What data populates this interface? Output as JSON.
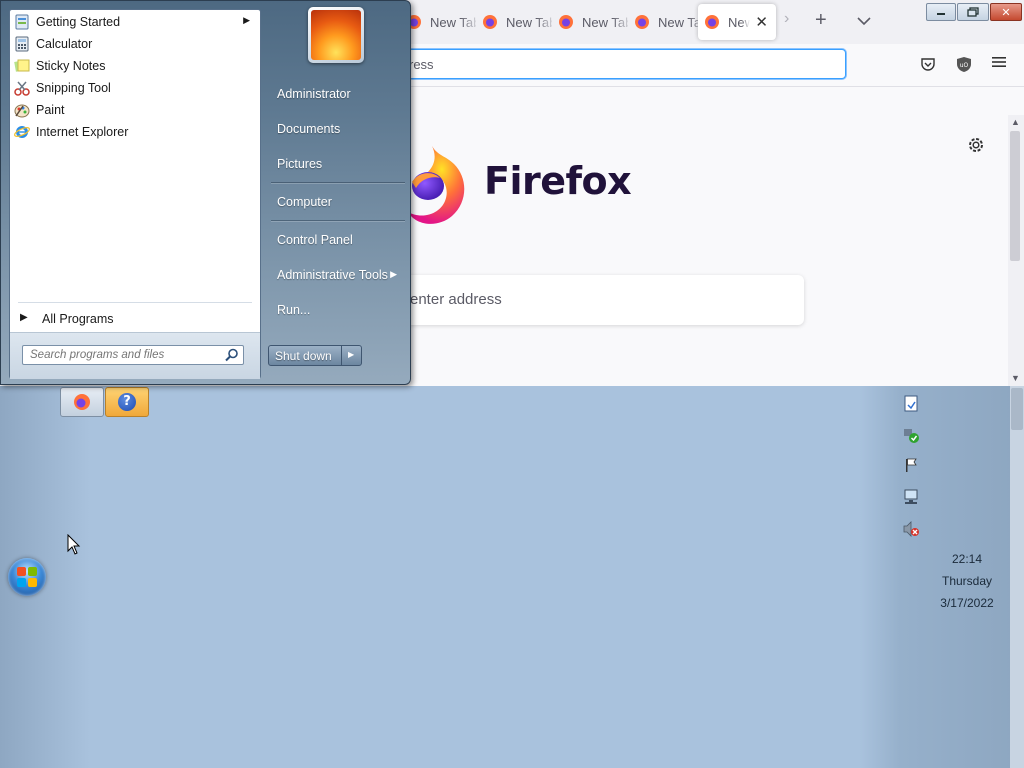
{
  "firefox": {
    "tabs": [
      {
        "label": "New Tab",
        "active": false
      },
      {
        "label": "New Tab",
        "active": false
      },
      {
        "label": "New Tab",
        "active": false
      },
      {
        "label": "New Tab",
        "active": false
      },
      {
        "label": "New Tab",
        "active": true
      }
    ],
    "urlbar_text": "ress",
    "wordmark": "Firefox",
    "search_placeholder": "enter address"
  },
  "start_menu": {
    "programs": [
      {
        "label": "Getting Started",
        "icon": "getting-started-icon",
        "has_submenu": true
      },
      {
        "label": "Calculator",
        "icon": "calculator-icon",
        "has_submenu": false
      },
      {
        "label": "Sticky Notes",
        "icon": "sticky-notes-icon",
        "has_submenu": false
      },
      {
        "label": "Snipping Tool",
        "icon": "snipping-tool-icon",
        "has_submenu": false
      },
      {
        "label": "Paint",
        "icon": "paint-icon",
        "has_submenu": false
      },
      {
        "label": "Internet Explorer",
        "icon": "internet-explorer-icon",
        "has_submenu": false
      }
    ],
    "all_programs": "All Programs",
    "search_placeholder": "Search programs and files",
    "right_items": [
      {
        "label": "Administrator"
      },
      {
        "label": "Documents"
      },
      {
        "label": "Pictures"
      },
      {
        "label": "Computer"
      },
      {
        "label": "Control Panel"
      },
      {
        "label": "Administrative Tools",
        "has_submenu": true
      },
      {
        "label": "Run..."
      }
    ],
    "shutdown_label": "Shut down"
  },
  "tray": {
    "time": "22:14",
    "day": "Thursday",
    "date": "3/17/2022"
  },
  "colors": {
    "desktop": "#a9c2dd",
    "firefox_accent": "#ff7139",
    "start_menu_panel": "#5f7a92"
  }
}
